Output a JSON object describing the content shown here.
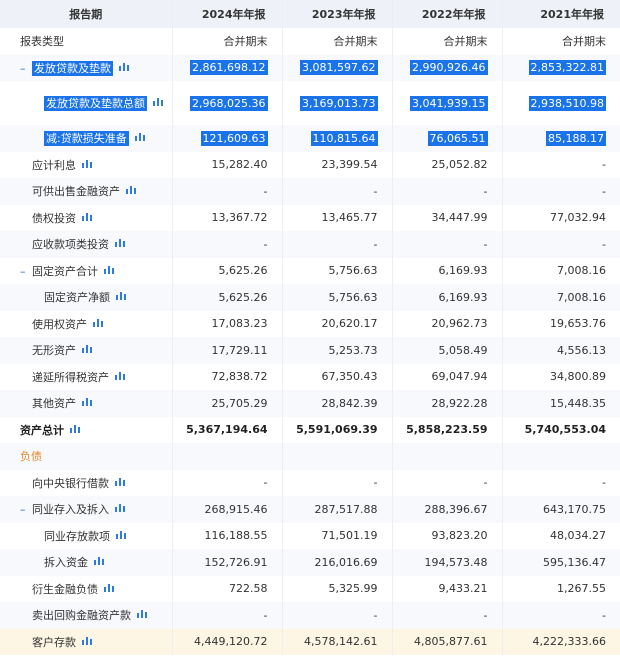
{
  "header": {
    "title": "报告期",
    "periods": [
      "2024年年报",
      "2023年年报",
      "2022年年报",
      "2021年年报"
    ]
  },
  "rows": [
    {
      "label": "报表类型",
      "values": [
        "合并期末",
        "合并期末",
        "合并期末",
        "合并期末"
      ],
      "indent": 0,
      "type": "plain"
    },
    {
      "label": "发放贷款及垫款",
      "values": [
        "2,861,698.12",
        "3,081,597.62",
        "2,990,926.46",
        "2,853,322.81"
      ],
      "indent": 1,
      "toggle": "–",
      "chart": true,
      "selected": true
    },
    {
      "label": "发放贷款及垫款总额",
      "values": [
        "2,968,025.36",
        "3,169,013.73",
        "3,041,939.15",
        "2,938,510.98"
      ],
      "indent": 2,
      "chart": true,
      "selected": true,
      "tall": true
    },
    {
      "label": "减:贷款损失准备",
      "values": [
        "121,609.63",
        "110,815.64",
        "76,065.51",
        "85,188.17"
      ],
      "indent": 2,
      "chart": true,
      "selected": true
    },
    {
      "label": "应计利息",
      "values": [
        "15,282.40",
        "23,399.54",
        "25,052.82",
        "-"
      ],
      "indent": 1,
      "chart": true
    },
    {
      "label": "可供出售金融资产",
      "values": [
        "-",
        "-",
        "-",
        "-"
      ],
      "indent": 1,
      "chart": true
    },
    {
      "label": "债权投资",
      "values": [
        "13,367.72",
        "13,465.77",
        "34,447.99",
        "77,032.94"
      ],
      "indent": 1,
      "chart": true
    },
    {
      "label": "应收款项类投资",
      "values": [
        "-",
        "-",
        "-",
        "-"
      ],
      "indent": 1,
      "chart": true
    },
    {
      "label": "固定资产合计",
      "values": [
        "5,625.26",
        "5,756.63",
        "6,169.93",
        "7,008.16"
      ],
      "indent": 1,
      "toggle": "–",
      "chart": true
    },
    {
      "label": "固定资产净额",
      "values": [
        "5,625.26",
        "5,756.63",
        "6,169.93",
        "7,008.16"
      ],
      "indent": 2,
      "chart": true
    },
    {
      "label": "使用权资产",
      "values": [
        "17,083.23",
        "20,620.17",
        "20,962.73",
        "19,653.76"
      ],
      "indent": 1,
      "chart": true
    },
    {
      "label": "无形资产",
      "values": [
        "17,729.11",
        "5,253.73",
        "5,058.49",
        "4,556.13"
      ],
      "indent": 1,
      "chart": true
    },
    {
      "label": "递延所得税资产",
      "values": [
        "72,838.72",
        "67,350.43",
        "69,047.94",
        "34,800.89"
      ],
      "indent": 1,
      "chart": true
    },
    {
      "label": "其他资产",
      "values": [
        "25,705.29",
        "28,842.39",
        "28,922.28",
        "15,448.35"
      ],
      "indent": 1,
      "chart": true
    },
    {
      "label": "资产总计",
      "values": [
        "5,367,194.64",
        "5,591,069.39",
        "5,858,223.59",
        "5,740,553.04"
      ],
      "indent": 0,
      "chart": true,
      "bold": true
    },
    {
      "label": "负债",
      "values": [
        "",
        "",
        "",
        ""
      ],
      "indent": 0,
      "section": true
    },
    {
      "label": "向中央银行借款",
      "values": [
        "-",
        "-",
        "-",
        "-"
      ],
      "indent": 1,
      "chart": true
    },
    {
      "label": "同业存入及拆入",
      "values": [
        "268,915.46",
        "287,517.88",
        "288,396.67",
        "643,170.75"
      ],
      "indent": 1,
      "toggle": "–",
      "chart": true
    },
    {
      "label": "同业存放款项",
      "values": [
        "116,188.55",
        "71,501.19",
        "93,823.20",
        "48,034.27"
      ],
      "indent": 2,
      "chart": true
    },
    {
      "label": "拆入资金",
      "values": [
        "152,726.91",
        "216,016.69",
        "194,573.48",
        "595,136.47"
      ],
      "indent": 2,
      "chart": true
    },
    {
      "label": "衍生金融负债",
      "values": [
        "722.58",
        "5,325.99",
        "9,433.21",
        "1,267.55"
      ],
      "indent": 1,
      "chart": true
    },
    {
      "label": "卖出回购金融资产款",
      "values": [
        "-",
        "-",
        "-",
        "-"
      ],
      "indent": 1,
      "chart": true
    },
    {
      "label": "客户存款",
      "values": [
        "4,449,120.72",
        "4,578,142.61",
        "4,805,877.61",
        "4,222,333.66"
      ],
      "indent": 1,
      "chart": true,
      "highlight": true
    }
  ],
  "colors": {
    "accent": "#1a73e8",
    "chart_icon": "#2d7be0",
    "section": "#e8872a",
    "header_bg": "#eef2f8"
  },
  "icon_names": {
    "chart": "bar-chart-icon",
    "toggle": "collapse-toggle-icon"
  }
}
